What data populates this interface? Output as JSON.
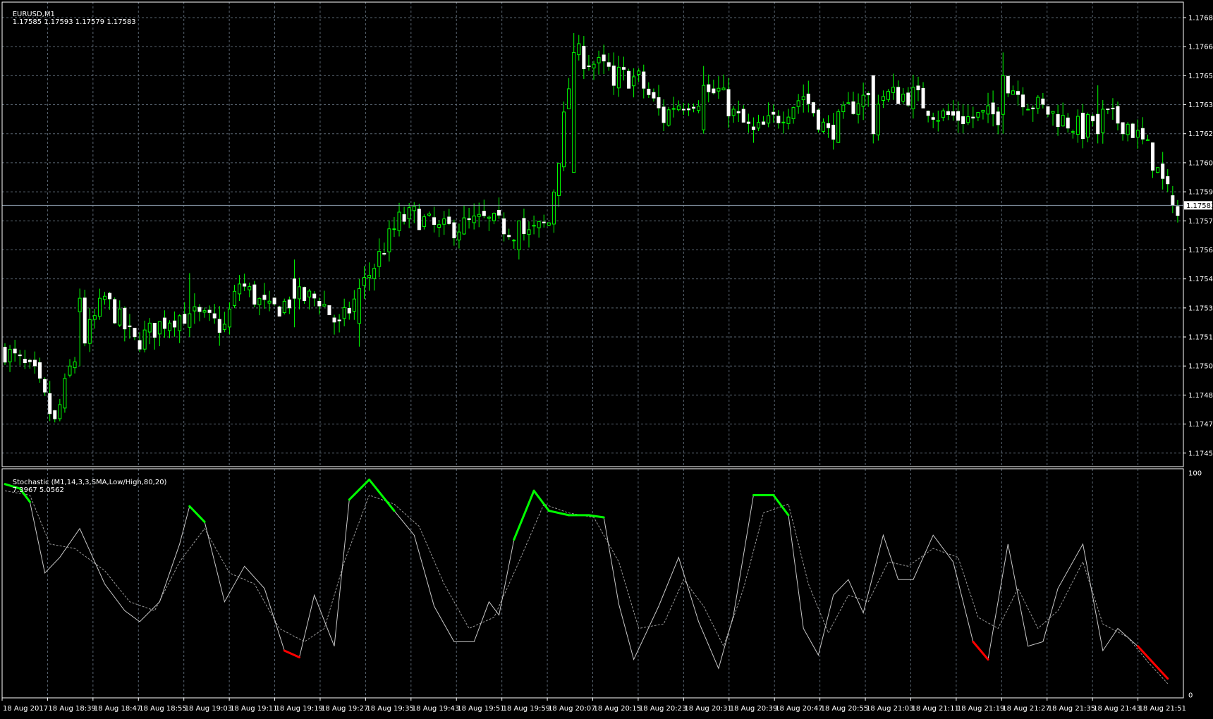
{
  "main_header": {
    "symbol_period": "EURUSD,M1",
    "ohlc": "1.17585 1.17593 1.17579 1.17583"
  },
  "indicator_header": {
    "name": "Stochastic (M1,14,3,3,SMA,Low/High,80,20)",
    "values": "7.3967 5.0562"
  },
  "current_price_label": "1.17583",
  "colors": {
    "background": "#000000",
    "grid": "#5a6672",
    "border": "#ffffff",
    "bull": "#00ff00",
    "bear": "#ffffff",
    "stoch_main": "#c8c8c8",
    "stoch_signal": "#9a9a9a",
    "stoch_overbought": "#00ff00",
    "stoch_oversold": "#ff0000",
    "price_line": "#8a9aaa"
  },
  "chart_data": [
    {
      "type": "candlestick",
      "symbol": "EURUSD",
      "timeframe": "M1",
      "y_ticks": [
        "1.17680",
        "1.17665",
        "1.17650",
        "1.17635",
        "1.17620",
        "1.17605",
        "1.17590",
        "1.17575",
        "1.17560",
        "1.17545",
        "1.17530",
        "1.17515",
        "1.17500",
        "1.17485",
        "1.17470",
        "1.17455"
      ],
      "ylim": [
        1.17448,
        1.17688
      ],
      "grid": true,
      "last_price": 1.17583,
      "x_ticks": [
        "18 Aug 2017",
        "18 Aug 18:39",
        "18 Aug 18:47",
        "18 Aug 18:55",
        "18 Aug 19:03",
        "18 Aug 19:11",
        "18 Aug 19:19",
        "18 Aug 19:27",
        "18 Aug 19:35",
        "18 Aug 19:43",
        "18 Aug 19:51",
        "18 Aug 19:59",
        "18 Aug 20:07",
        "18 Aug 20:15",
        "18 Aug 20:23",
        "18 Aug 20:31",
        "18 Aug 20:39",
        "18 Aug 20:47",
        "18 Aug 20:55",
        "18 Aug 21:03",
        "18 Aug 21:11",
        "18 Aug 21:19",
        "18 Aug 21:27",
        "18 Aug 21:35",
        "18 Aug 21:43",
        "18 Aug 21:51"
      ],
      "close_path": [
        [
          0,
          1.17508
        ],
        [
          6,
          1.17495
        ],
        [
          10,
          1.1747
        ],
        [
          13,
          1.17498
        ],
        [
          20,
          1.17535
        ],
        [
          26,
          1.17512
        ],
        [
          33,
          1.17525
        ],
        [
          37,
          1.17527
        ],
        [
          44,
          1.1752
        ],
        [
          47,
          1.17543
        ],
        [
          53,
          1.17528
        ],
        [
          58,
          1.17535
        ],
        [
          63,
          1.17535
        ],
        [
          67,
          1.1752
        ],
        [
          72,
          1.17543
        ],
        [
          79,
          1.17575
        ],
        [
          82,
          1.17578
        ],
        [
          87,
          1.1757
        ],
        [
          96,
          1.17575
        ],
        [
          105,
          1.17568
        ],
        [
          109,
          1.17574
        ],
        [
          114,
          1.17662
        ],
        [
          119,
          1.17655
        ],
        [
          123,
          1.1765
        ],
        [
          127,
          1.17648
        ],
        [
          132,
          1.17628
        ],
        [
          134,
          1.17635
        ],
        [
          138,
          1.17638
        ],
        [
          143,
          1.17642
        ],
        [
          146,
          1.1763
        ],
        [
          150,
          1.1762
        ],
        [
          153,
          1.17625
        ],
        [
          160,
          1.1764
        ],
        [
          165,
          1.1762
        ],
        [
          171,
          1.17638
        ],
        [
          177,
          1.1764
        ],
        [
          182,
          1.1764
        ],
        [
          187,
          1.1763
        ],
        [
          193,
          1.17628
        ],
        [
          199,
          1.1763
        ],
        [
          201,
          1.17646
        ],
        [
          205,
          1.17637
        ],
        [
          210,
          1.1763
        ],
        [
          216,
          1.17622
        ],
        [
          219,
          1.1763
        ],
        [
          225,
          1.17625
        ],
        [
          229,
          1.17612
        ],
        [
          234,
          1.17583
        ]
      ],
      "candles": [
        {
          "i": 15,
          "o": 1.17528,
          "h": 1.1754,
          "l": 1.175,
          "c": 1.17535
        },
        {
          "i": 37,
          "o": 1.1752,
          "h": 1.17548,
          "l": 1.17515,
          "c": 1.17527
        },
        {
          "i": 58,
          "o": 1.17545,
          "h": 1.17555,
          "l": 1.1752,
          "c": 1.17535
        },
        {
          "i": 71,
          "o": 1.17522,
          "h": 1.17545,
          "l": 1.1751,
          "c": 1.1754
        },
        {
          "i": 103,
          "o": 1.1756,
          "h": 1.17568,
          "l": 1.17555,
          "c": 1.17575
        },
        {
          "i": 114,
          "o": 1.176,
          "h": 1.17672,
          "l": 1.176,
          "c": 1.17662
        },
        {
          "i": 122,
          "o": 1.17655,
          "h": 1.17662,
          "l": 1.1764,
          "c": 1.17645
        },
        {
          "i": 140,
          "o": 1.17622,
          "h": 1.17655,
          "l": 1.1762,
          "c": 1.17645
        },
        {
          "i": 174,
          "o": 1.1765,
          "h": 1.1765,
          "l": 1.17615,
          "c": 1.1762
        },
        {
          "i": 200,
          "o": 1.1763,
          "h": 1.17662,
          "l": 1.1762,
          "c": 1.1765
        },
        {
          "i": 219,
          "o": 1.1763,
          "h": 1.17645,
          "l": 1.17615,
          "c": 1.1762
        },
        {
          "i": 234,
          "o": 1.17588,
          "h": 1.17593,
          "l": 1.17579,
          "c": 1.17583
        }
      ]
    },
    {
      "type": "line",
      "name": "Stochastic (M1,14,3,3,SMA,Low/High,80,20)",
      "ylim": [
        0,
        100
      ],
      "y_ticks": [
        "100",
        "0"
      ],
      "levels": {
        "overbought": 80,
        "oversold": 20
      },
      "last_values": {
        "main": 7.3967,
        "signal": 5.0562
      },
      "main_path": [
        [
          0,
          95
        ],
        [
          3,
          93
        ],
        [
          5,
          87
        ],
        [
          8,
          55
        ],
        [
          11,
          62
        ],
        [
          15,
          75
        ],
        [
          20,
          50
        ],
        [
          24,
          38
        ],
        [
          27,
          33
        ],
        [
          31,
          42
        ],
        [
          35,
          68
        ],
        [
          37,
          85
        ],
        [
          40,
          78
        ],
        [
          44,
          42
        ],
        [
          48,
          58
        ],
        [
          52,
          48
        ],
        [
          56,
          20
        ],
        [
          59,
          17
        ],
        [
          62,
          45
        ],
        [
          66,
          22
        ],
        [
          69,
          88
        ],
        [
          73,
          97
        ],
        [
          78,
          83
        ],
        [
          82,
          72
        ],
        [
          86,
          40
        ],
        [
          90,
          24
        ],
        [
          94,
          24
        ],
        [
          97,
          42
        ],
        [
          99,
          36
        ],
        [
          102,
          70
        ],
        [
          106,
          92
        ],
        [
          109,
          83
        ],
        [
          113,
          81
        ],
        [
          117,
          81
        ],
        [
          120,
          80
        ],
        [
          123,
          41
        ],
        [
          126,
          16
        ],
        [
          131,
          40
        ],
        [
          135,
          62
        ],
        [
          139,
          33
        ],
        [
          143,
          12
        ],
        [
          146,
          36
        ],
        [
          150,
          90
        ],
        [
          154,
          90
        ],
        [
          157,
          81
        ],
        [
          160,
          30
        ],
        [
          163,
          18
        ],
        [
          166,
          45
        ],
        [
          169,
          52
        ],
        [
          172,
          37
        ],
        [
          176,
          72
        ],
        [
          179,
          52
        ],
        [
          182,
          52
        ],
        [
          186,
          72
        ],
        [
          190,
          60
        ],
        [
          194,
          24
        ],
        [
          197,
          16
        ],
        [
          201,
          68
        ],
        [
          205,
          22
        ],
        [
          208,
          24
        ],
        [
          211,
          48
        ],
        [
          216,
          68
        ],
        [
          220,
          20
        ],
        [
          223,
          30
        ],
        [
          227,
          22
        ],
        [
          233,
          7.4
        ]
      ],
      "signal_path": [
        [
          0,
          92
        ],
        [
          5,
          90
        ],
        [
          9,
          68
        ],
        [
          14,
          66
        ],
        [
          20,
          56
        ],
        [
          25,
          42
        ],
        [
          30,
          38
        ],
        [
          35,
          60
        ],
        [
          40,
          75
        ],
        [
          45,
          55
        ],
        [
          50,
          50
        ],
        [
          55,
          30
        ],
        [
          60,
          24
        ],
        [
          64,
          30
        ],
        [
          68,
          60
        ],
        [
          73,
          90
        ],
        [
          78,
          86
        ],
        [
          83,
          76
        ],
        [
          88,
          50
        ],
        [
          93,
          30
        ],
        [
          98,
          35
        ],
        [
          103,
          60
        ],
        [
          108,
          86
        ],
        [
          113,
          82
        ],
        [
          118,
          80
        ],
        [
          123,
          60
        ],
        [
          127,
          30
        ],
        [
          132,
          32
        ],
        [
          136,
          52
        ],
        [
          140,
          40
        ],
        [
          144,
          22
        ],
        [
          148,
          48
        ],
        [
          152,
          82
        ],
        [
          157,
          86
        ],
        [
          161,
          50
        ],
        [
          165,
          28
        ],
        [
          169,
          45
        ],
        [
          173,
          42
        ],
        [
          177,
          60
        ],
        [
          181,
          58
        ],
        [
          186,
          66
        ],
        [
          191,
          62
        ],
        [
          195,
          35
        ],
        [
          199,
          30
        ],
        [
          203,
          48
        ],
        [
          207,
          30
        ],
        [
          211,
          38
        ],
        [
          216,
          60
        ],
        [
          220,
          32
        ],
        [
          225,
          26
        ],
        [
          229,
          15
        ],
        [
          233,
          5.1
        ]
      ]
    }
  ]
}
